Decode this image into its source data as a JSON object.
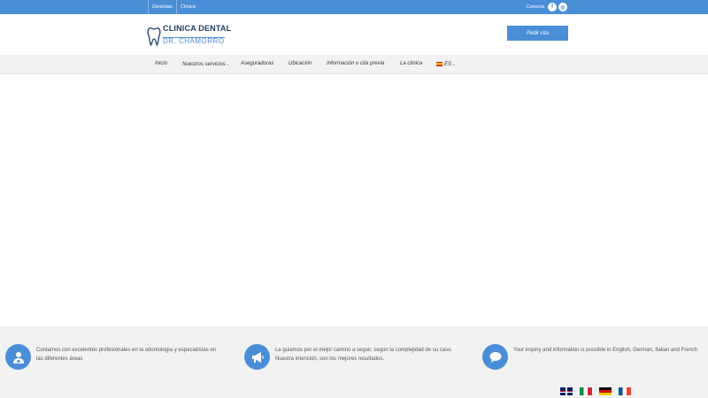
{
  "topbar": {
    "links": [
      "Dentistas",
      "Clínica"
    ],
    "connect_label": "Conecta",
    "social": [
      {
        "icon": "facebook-icon",
        "glyph": "f"
      },
      {
        "icon": "instagram-icon",
        "glyph": "◎"
      }
    ]
  },
  "header": {
    "logo_line1": "CLINICA DENTAL",
    "logo_line2": "DR. CHAMORRO",
    "cta_label": "Pedir cita"
  },
  "nav": {
    "items": [
      "Inicio",
      "Nuestros servicios",
      "Aseguradoras",
      "Ubicación",
      "Información o cita previa",
      "La clínica"
    ],
    "language": "ES"
  },
  "footer": {
    "features": [
      {
        "icon": "doctor-icon",
        "text": "Contamos con excelentes profesionales en la odontología y especialistas en las diferentes áreas"
      },
      {
        "icon": "megaphone-icon",
        "text": "Le guiamos por el mejor camino a seguir, según la complejidad de su caso. Nuestra intención, son los mejores resultados."
      },
      {
        "icon": "chat-bubble-icon",
        "text": "Your inquiry and information is possible in English, German, Italian and French"
      }
    ],
    "flags": [
      "english-flag",
      "italian-flag",
      "german-flag",
      "french-flag"
    ]
  },
  "colors": {
    "brand_blue": "#4a8ed8",
    "logo_navy": "#1f3f63",
    "nav_bg": "#f2f2f2"
  }
}
